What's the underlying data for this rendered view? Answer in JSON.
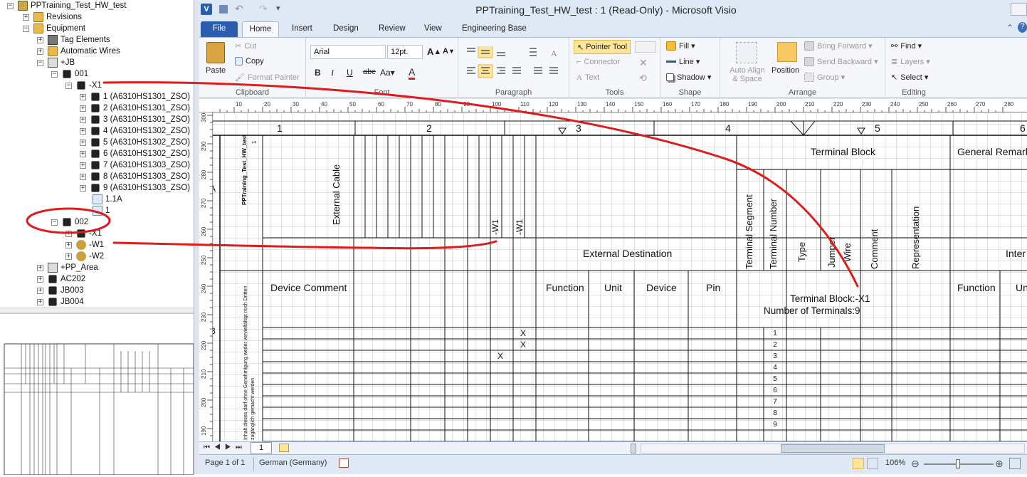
{
  "tree": {
    "root": "PPTraining_Test_HW_test",
    "revisions": "Revisions",
    "equipment": "Equipment",
    "tag_elements": "Tag Elements",
    "automatic_wires": "Automatic Wires",
    "jb": "+JB",
    "n001": "001",
    "x1": "-X1",
    "terminals": [
      "1 (A6310HS1301_ZSO)",
      "2 (A6310HS1301_ZSO)",
      "3 (A6310HS1301_ZSO)",
      "4 (A6310HS1302_ZSO)",
      "5 (A6310HS1302_ZSO)",
      "6 (A6310HS1302_ZSO)",
      "7 (A6310HS1303_ZSO)",
      "8 (A6310HS1303_ZSO)",
      "9 (A6310HS1303_ZSO)"
    ],
    "item_1_1a": "1.1A",
    "item_1": "1",
    "n002": "002",
    "x1b": "-X1",
    "w1": "-W1",
    "w2": "-W2",
    "pp_area": "+PP_Area",
    "ac202": "AC202",
    "jb003": "JB003",
    "jb004": "JB004"
  },
  "window": {
    "title": "PPTraining_Test_HW_test : 1 (Read-Only) - Microsoft Visio",
    "help": "?"
  },
  "tabs": [
    "File",
    "Home",
    "Insert",
    "Design",
    "Review",
    "View",
    "Engineering Base"
  ],
  "ribbon": {
    "paste": "Paste",
    "cut": "Cut",
    "copy": "Copy",
    "format_painter": "Format Painter",
    "clipboard": "Clipboard",
    "font_name": "Arial",
    "font_size": "12pt.",
    "font": "Font",
    "paragraph": "Paragraph",
    "pointer_tool": "Pointer Tool",
    "connector": "Connector",
    "text": "Text",
    "tools": "Tools",
    "fill": "Fill",
    "line": "Line",
    "shadow": "Shadow",
    "shape": "Shape",
    "auto_align": "Auto Align & Space",
    "position": "Position",
    "bring_forward": "Bring Forward",
    "send_backward": "Send Backward",
    "group": "Group",
    "arrange": "Arrange",
    "find": "Find",
    "layers": "Layers",
    "select": "Select",
    "editing": "Editing"
  },
  "ruler_h": [
    "10",
    "20",
    "30",
    "40",
    "50",
    "60",
    "70",
    "80",
    "90",
    "100",
    "110",
    "120",
    "130",
    "140",
    "150",
    "160",
    "170",
    "180",
    "190",
    "200",
    "210",
    "220",
    "230",
    "240",
    "250",
    "260",
    "270",
    "280"
  ],
  "ruler_v": [
    "300",
    "290",
    "280",
    "270",
    "260",
    "250",
    "240",
    "230",
    "220",
    "210",
    "200",
    "190"
  ],
  "sheet": {
    "cols": [
      "1",
      "2",
      "3",
      "4",
      "5",
      "6"
    ],
    "row_a": "A",
    "row_b": "B",
    "title_vertical": "PPTraining_Test_HW_test",
    "title_vertical_2": "1",
    "external_cable": "External Cable",
    "w1_a": "-W1",
    "w1_b": "-W1",
    "terminal_block": "Terminal Block",
    "general_remarks": "General Remark",
    "terminal_segment": "Terminal Segment",
    "terminal_number": "Terminal Number",
    "type": "Type",
    "jumper": "Jumper",
    "wire": "Wire",
    "comment": "Comment",
    "representation": "Representation",
    "external_destination": "External Destination",
    "internal": "Inter",
    "device_comment": "Device Comment",
    "function": "Function",
    "unit": "Unit",
    "device": "Device",
    "pin": "Pin",
    "function2": "Function",
    "unit2": "Un",
    "tb_name": "Terminal Block:-X1",
    "tb_count": "Number of Terminals:9",
    "side_note": "Inhalt dieses darf ohne Genehmigung weder vervielfältigt noch Dritten zugänglich gemacht werden",
    "marks": [
      "X",
      "X",
      "X"
    ],
    "terminal_numbers": [
      "1",
      "2",
      "3",
      "4",
      "5",
      "6",
      "7",
      "8",
      "9"
    ]
  },
  "pagebar": {
    "page_tab": "1"
  },
  "status": {
    "page": "Page 1 of 1",
    "language": "German (Germany)",
    "zoom": "106%"
  },
  "annotation_color": "#e01b1b"
}
